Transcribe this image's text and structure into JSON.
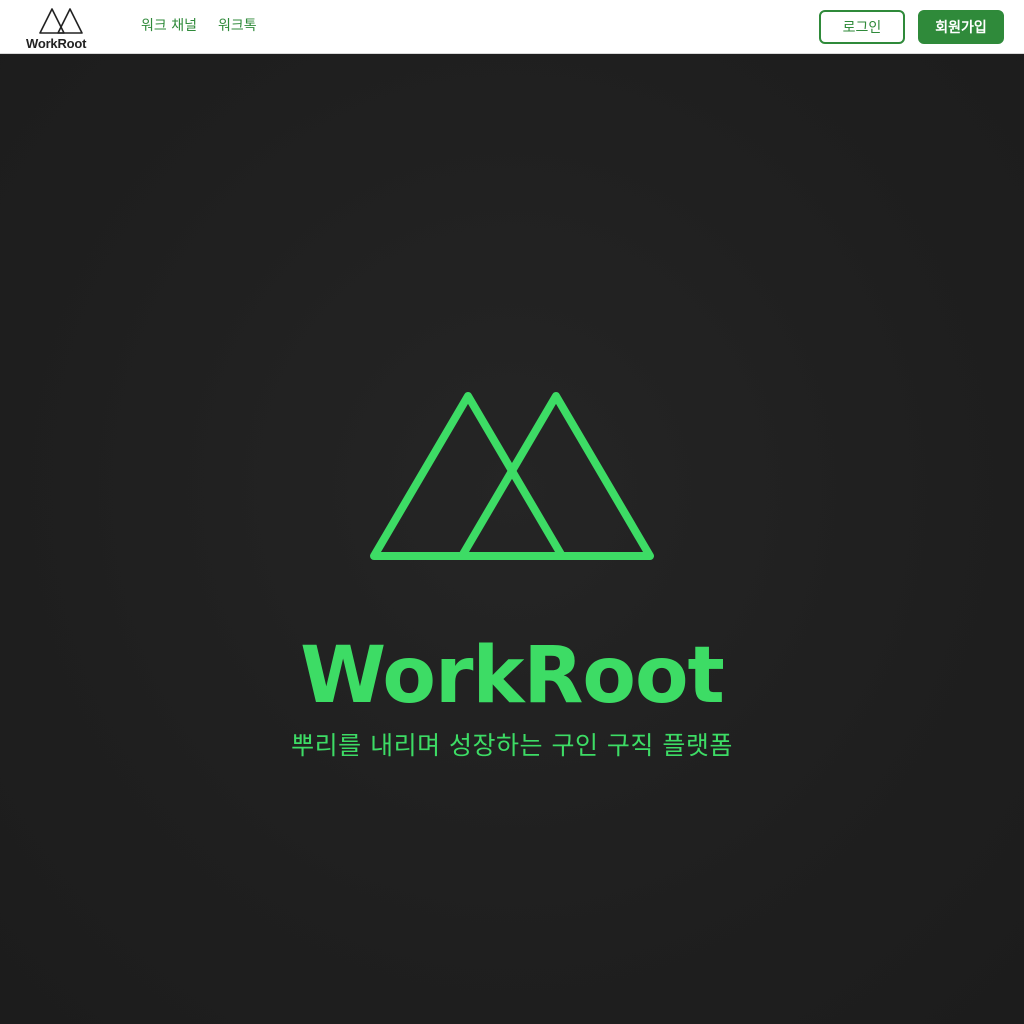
{
  "header": {
    "brand_name": "WorkRoot",
    "nav": {
      "work_channel": "워크 채널",
      "work_talk": "워크톡"
    },
    "login_label": "로그인",
    "signup_label": "회원가입"
  },
  "hero": {
    "logo_icon": "workroot-mountain-icon",
    "title": "WorkRoot",
    "tagline": "뿌리를 내리며 성장하는 구인 구직 플랫폼"
  },
  "colors": {
    "brand_green": "#2f8a3a",
    "hero_green": "#3ddc65",
    "hero_background": "#1f1f1f",
    "header_background": "#ffffff"
  }
}
